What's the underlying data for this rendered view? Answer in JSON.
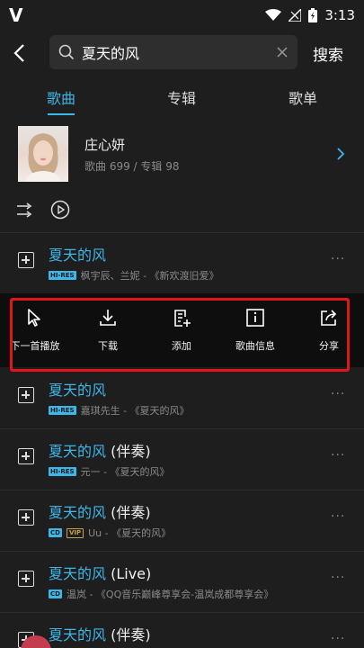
{
  "status": {
    "logo": "V",
    "time": "3:13"
  },
  "search": {
    "query": "夏天的风",
    "action_label": "搜索"
  },
  "tabs": [
    {
      "label": "歌曲"
    },
    {
      "label": "专辑"
    },
    {
      "label": "歌单"
    }
  ],
  "artist": {
    "name": "庄心妍",
    "meta": "歌曲 699 / 专辑 98"
  },
  "songs": [
    {
      "title": "夏天的风",
      "suffix": "",
      "badges": [
        "HI-RES"
      ],
      "info": "枫宇辰、兰妮 - 《新欢渡旧爱》"
    },
    {
      "title": "夏天的风",
      "suffix": "",
      "badges": [
        "HI-RES"
      ],
      "info": "嘉琪先生 - 《夏天的风》"
    },
    {
      "title": "夏天的风",
      "suffix": " (伴奏)",
      "badges": [
        "HI-RES"
      ],
      "info": "元一 - 《夏天的风》"
    },
    {
      "title": "夏天的风",
      "suffix": " (伴奏)",
      "badges": [
        "CD",
        "VIP"
      ],
      "info": "Uu - 《夏天的风》"
    },
    {
      "title": "夏天的风",
      "suffix": " (Live)",
      "badges": [
        "CD"
      ],
      "info": "温岚 - 《QQ音乐巅峰尊享会-温岚成都尊享会》"
    },
    {
      "title": "夏天的风",
      "suffix": " (伴奏)",
      "badges": [],
      "info": ""
    }
  ],
  "action_menu": {
    "items": [
      {
        "label": "下一首播放",
        "icon": "cursor-next-icon"
      },
      {
        "label": "下载",
        "icon": "download-icon"
      },
      {
        "label": "添加",
        "icon": "add-to-list-icon"
      },
      {
        "label": "歌曲信息",
        "icon": "info-icon"
      },
      {
        "label": "分享",
        "icon": "share-icon"
      }
    ]
  },
  "more_glyph": "···",
  "colors": {
    "accent": "#3fb6e8",
    "highlight_frame": "#e3141b",
    "background": "#1e1e1e"
  }
}
